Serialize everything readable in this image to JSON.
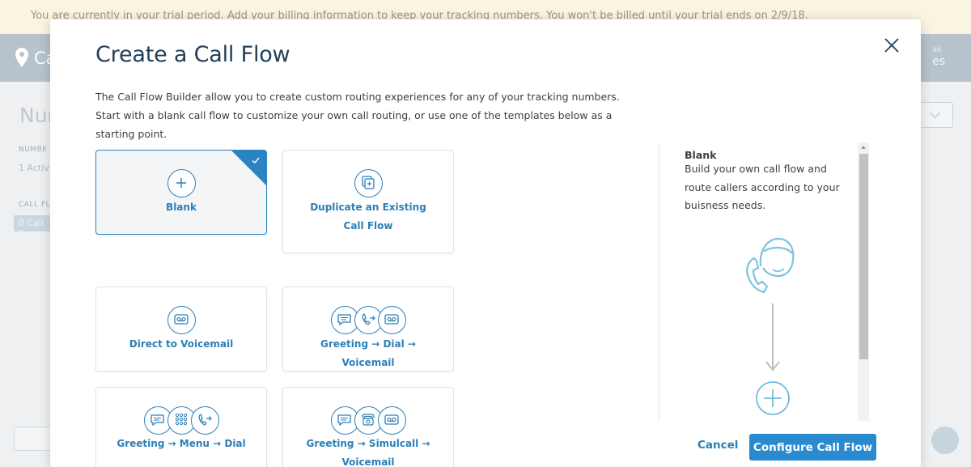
{
  "trial_banner": "You are currently in your trial period. Add your billing information to keep your tracking numbers. You won't be billed until your trial ends on 2/9/18.",
  "app": {
    "logo_text": "Ca",
    "account_top": "ak",
    "account_bottom": "es",
    "page_title": "Nur",
    "numbers_label": "NUMBE",
    "numbers_value": "1 Activ",
    "call_flows_label": "CALL FL",
    "call_flows_pill": "0 Call F"
  },
  "modal": {
    "title": "Create a Call Flow",
    "description": "The Call Flow Builder allow you to create custom routing experiences for any of your tracking numbers. Start with a blank call flow to customize your own call routing, or use one of the templates below as a starting point.",
    "templates": [
      {
        "label": "Blank",
        "selected": true,
        "icons": [
          "plus-icon"
        ]
      },
      {
        "label": "Duplicate an Existing Call Flow",
        "selected": false,
        "icons": [
          "duplicate-icon"
        ]
      },
      {
        "label": "Direct to Voicemail",
        "selected": false,
        "icons": [
          "voicemail-icon"
        ]
      },
      {
        "label": "Greeting → Dial → Voicemail",
        "selected": false,
        "icons": [
          "greeting-icon",
          "dial-icon",
          "voicemail-icon"
        ]
      },
      {
        "label": "Greeting → Menu → Dial",
        "selected": false,
        "icons": [
          "greeting-icon",
          "keypad-icon",
          "dial-icon"
        ]
      },
      {
        "label": "Greeting → Simulcall → Voicemail",
        "selected": false,
        "icons": [
          "greeting-icon",
          "simulcall-icon",
          "voicemail-icon"
        ]
      }
    ],
    "preview": {
      "title": "Blank",
      "description": "Build your own call flow and route callers according to your buisness needs."
    },
    "cancel_label": "Cancel",
    "configure_label": "Configure Call Flow"
  },
  "colors": {
    "accent": "#2c7fb8",
    "primary_button": "#2a8ad0",
    "title": "#23405a",
    "banner": "#fbf4e1"
  }
}
